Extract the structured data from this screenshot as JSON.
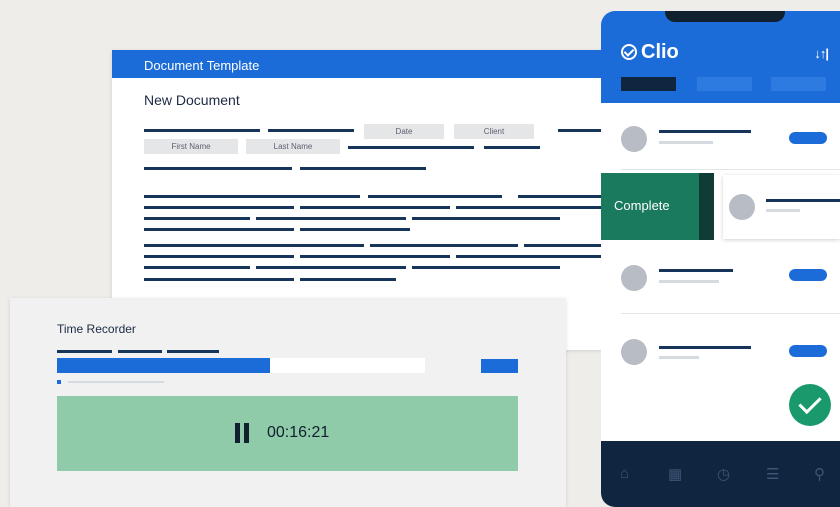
{
  "document": {
    "title": "Document Template",
    "subtitle": "New Document",
    "fields": {
      "date": "Date",
      "client": "Client",
      "first_name": "First Name",
      "last_name": "Last Name"
    }
  },
  "time_recorder": {
    "title": "Time Recorder",
    "progress_fraction": 0.58,
    "elapsed": "00:16:21",
    "icons": {
      "control": "pause-icon"
    }
  },
  "phone": {
    "logo": "Clio",
    "swipe_action": "Complete",
    "icons": {
      "logo": "check-circle-icon",
      "header": "filter-icon",
      "fab": "checkmark-icon",
      "nav": [
        "home-icon",
        "calendar-icon",
        "clock-icon",
        "list-icon",
        "search-icon"
      ]
    }
  },
  "colors": {
    "brand_blue": "#1b6cd8",
    "navy": "#10253f",
    "complete_green": "#1a7a5e",
    "timer_green": "#8fcaa9",
    "check_green": "#1a9a6c"
  }
}
